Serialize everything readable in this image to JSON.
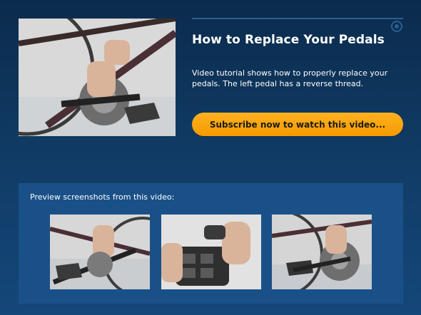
{
  "video": {
    "title": "How to Replace Your Pedals",
    "description": "Video tutorial shows how to properly replace your pedals. The left pedal has a reverse thread.",
    "subscribe_label": "Subscribe now to watch this video..."
  },
  "preview": {
    "label": "Preview screenshots from this video:",
    "screenshots": [
      {
        "icon": "pedal-wrench-screenshot"
      },
      {
        "icon": "pedal-close-up-screenshot"
      },
      {
        "icon": "pedal-installed-screenshot"
      }
    ]
  },
  "colors": {
    "background": "#0b2b4d",
    "accent_button": "#f59a00",
    "panel": "#1a5088"
  }
}
